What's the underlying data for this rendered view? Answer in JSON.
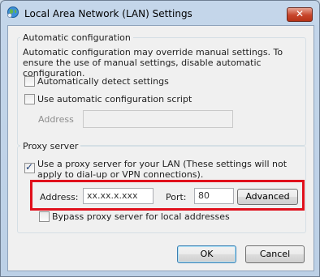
{
  "window": {
    "title": "Local Area Network (LAN) Settings",
    "close_glyph": "✕"
  },
  "auto_config": {
    "group_title": "Automatic configuration",
    "description": "Automatic configuration may override manual settings.  To ensure the use of manual settings, disable automatic configuration.",
    "detect_settings": {
      "label": "Automatically detect settings",
      "checked": false
    },
    "use_script": {
      "label": "Use automatic configuration script",
      "checked": false
    },
    "address_label": "Address",
    "address_value": ""
  },
  "proxy": {
    "group_title": "Proxy server",
    "use_proxy": {
      "label": "Use a proxy server for your LAN (These settings will not apply to dial-up or VPN connections).",
      "checked": true
    },
    "address_label": "Address:",
    "address_value": "xx.xx.x.xxx",
    "port_label": "Port:",
    "port_value": "80",
    "advanced_label": "Advanced",
    "bypass_local": {
      "label": "Bypass proxy server for local addresses",
      "checked": false
    },
    "highlight_color": "#e0101c"
  },
  "buttons": {
    "ok_label": "OK",
    "cancel_label": "Cancel"
  }
}
